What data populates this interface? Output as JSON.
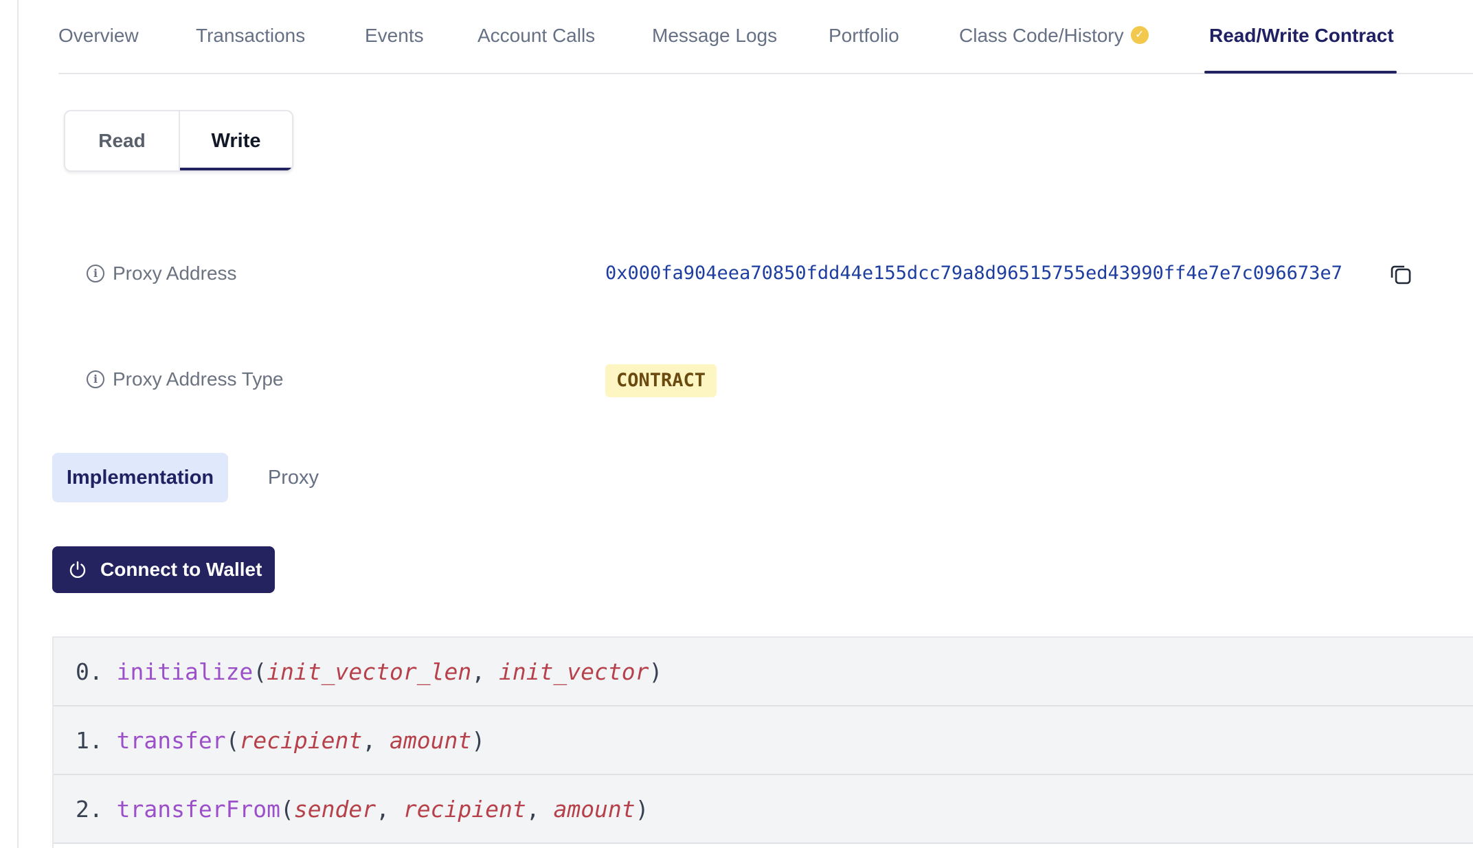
{
  "tabs": [
    {
      "label": "Overview"
    },
    {
      "label": "Transactions"
    },
    {
      "label": "Events"
    },
    {
      "label": "Account Calls"
    },
    {
      "label": "Message Logs"
    },
    {
      "label": "Portfolio"
    },
    {
      "label": "Class Code/History"
    },
    {
      "label": "Read/Write Contract",
      "active": true
    }
  ],
  "verified_check": "✓",
  "rw": {
    "read": "Read",
    "write": "Write",
    "selected": "Write"
  },
  "info": {
    "icon_glyph": "i",
    "proxy_address_label": "Proxy Address",
    "proxy_address_value": "0x000fa904eea70850fdd44e155dcc79a8d96515755ed43990ff4e7e7c096673e7",
    "proxy_type_label": "Proxy Address Type",
    "proxy_type_value": "CONTRACT"
  },
  "subtabs": {
    "implementation": "Implementation",
    "proxy": "Proxy",
    "selected": "Implementation"
  },
  "connect_button": "Connect to Wallet",
  "functions": [
    {
      "index": "0.",
      "name": "initialize",
      "params": [
        "init_vector_len",
        "init_vector"
      ]
    },
    {
      "index": "1.",
      "name": "transfer",
      "params": [
        "recipient",
        "amount"
      ]
    },
    {
      "index": "2.",
      "name": "transferFrom",
      "params": [
        "sender",
        "recipient",
        "amount"
      ]
    }
  ],
  "colors": {
    "accent": "#24235f",
    "address": "#1d3ea0",
    "badge_bg": "#fdf6c3",
    "fn_name": "#9b4fc9",
    "fn_param": "#b6414a"
  }
}
